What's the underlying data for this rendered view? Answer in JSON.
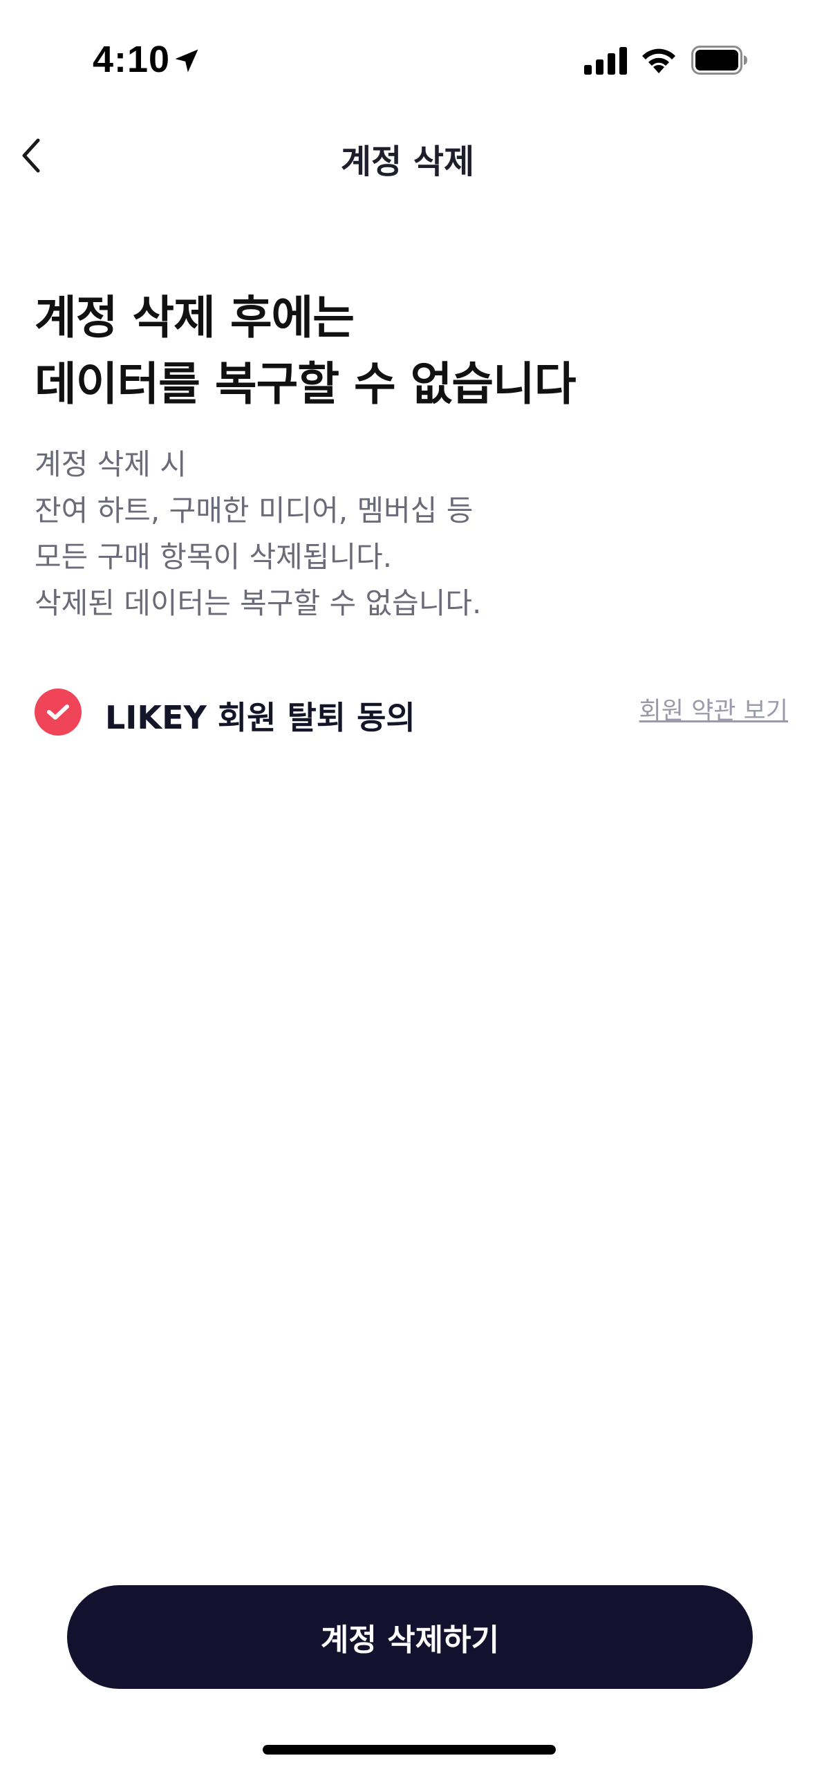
{
  "status_bar": {
    "time": "4:10",
    "icons": [
      "location-arrow-icon",
      "cellular-signal-icon",
      "wifi-icon",
      "battery-icon"
    ]
  },
  "nav": {
    "back_icon": "chevron-left-icon",
    "title": "계정 삭제"
  },
  "headline": {
    "line1": "계정 삭제 후에는",
    "line2": "데이터를 복구할 수 없습니다"
  },
  "description": {
    "lines": [
      "계정 삭제 시",
      "잔여 하트, 구매한 미디어, 멤버십 등",
      "모든 구매 항목이 삭제됩니다.",
      "삭제된 데이터는 복구할 수 없습니다."
    ]
  },
  "agreement": {
    "checked": true,
    "label": "LIKEY 회원 탈퇴 동의",
    "terms_link": "회원 약관 보기"
  },
  "actions": {
    "delete_label": "계정 삭제하기"
  },
  "colors": {
    "accent_check": "#f04458",
    "primary_button": "#14112e",
    "description_text": "#6a6a78",
    "link_text": "#9a9aaa"
  }
}
